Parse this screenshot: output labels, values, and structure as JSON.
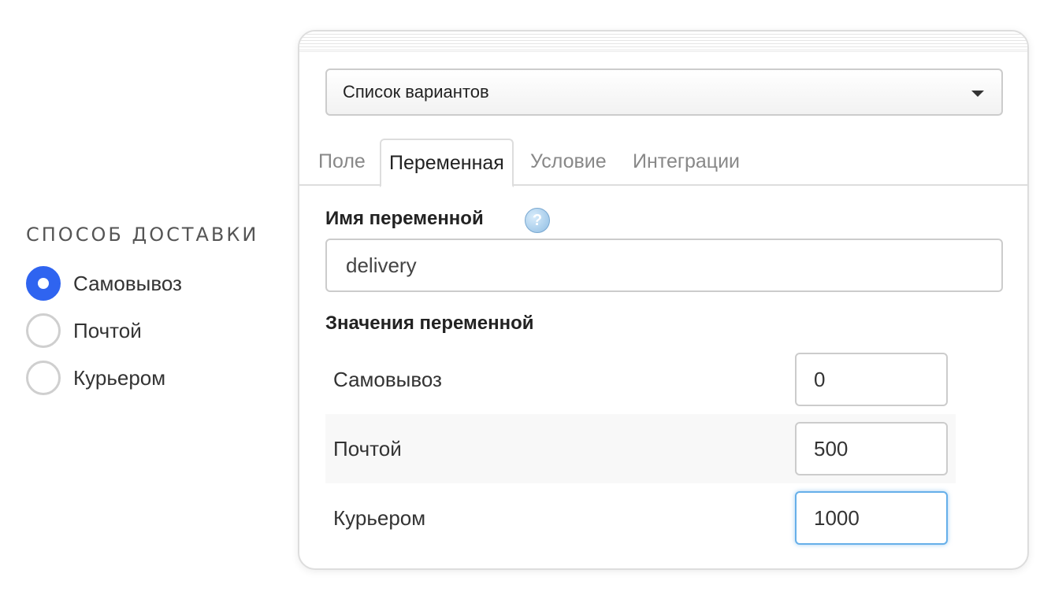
{
  "preview": {
    "title": "СПОСОБ ДОСТАВКИ",
    "options": [
      {
        "label": "Самовывоз",
        "checked": true
      },
      {
        "label": "Почтой",
        "checked": false
      },
      {
        "label": "Курьером",
        "checked": false
      }
    ]
  },
  "panel": {
    "field_type": "Список вариантов",
    "tabs": [
      "Поле",
      "Переменная",
      "Условие",
      "Интеграции"
    ],
    "active_tab": "Переменная",
    "variable_name_label": "Имя переменной",
    "help_icon_glyph": "?",
    "variable_name_value": "delivery",
    "variable_values_label": "Значения переменной",
    "values": [
      {
        "label": "Самовывоз",
        "value": "0"
      },
      {
        "label": "Почтой",
        "value": "500"
      },
      {
        "label": "Курьером",
        "value": "1000"
      }
    ]
  },
  "colors": {
    "radio_checked": "#2f64f0",
    "focus_border": "#66afe9"
  }
}
